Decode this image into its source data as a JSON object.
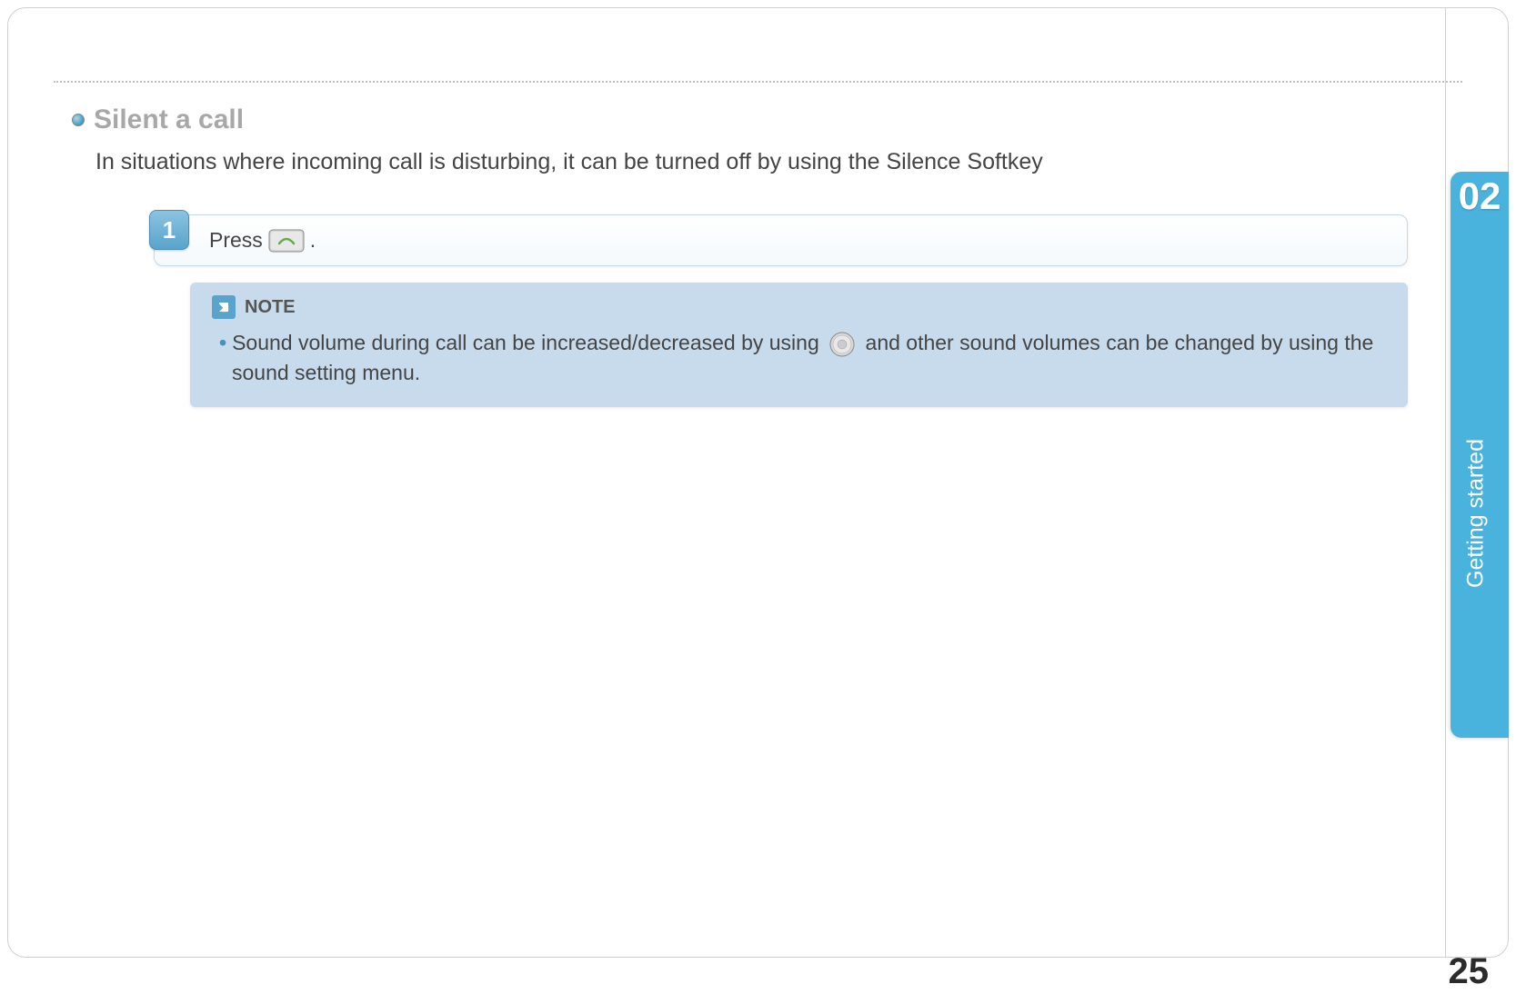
{
  "section": {
    "title": "Silent a call",
    "description": "In situations where incoming call is disturbing, it can be turned off by using the Silence Softkey"
  },
  "step": {
    "number": "1",
    "text_before": "Press",
    "text_after": " ."
  },
  "note": {
    "label": "NOTE",
    "bullet": "•",
    "text_part1": "Sound volume during call can be increased/decreased by using",
    "text_part2": "and other sound volumes can be changed by using the sound setting menu."
  },
  "side_tab": {
    "chapter_number": "02",
    "chapter_label": "Getting started"
  },
  "page_number": "25"
}
